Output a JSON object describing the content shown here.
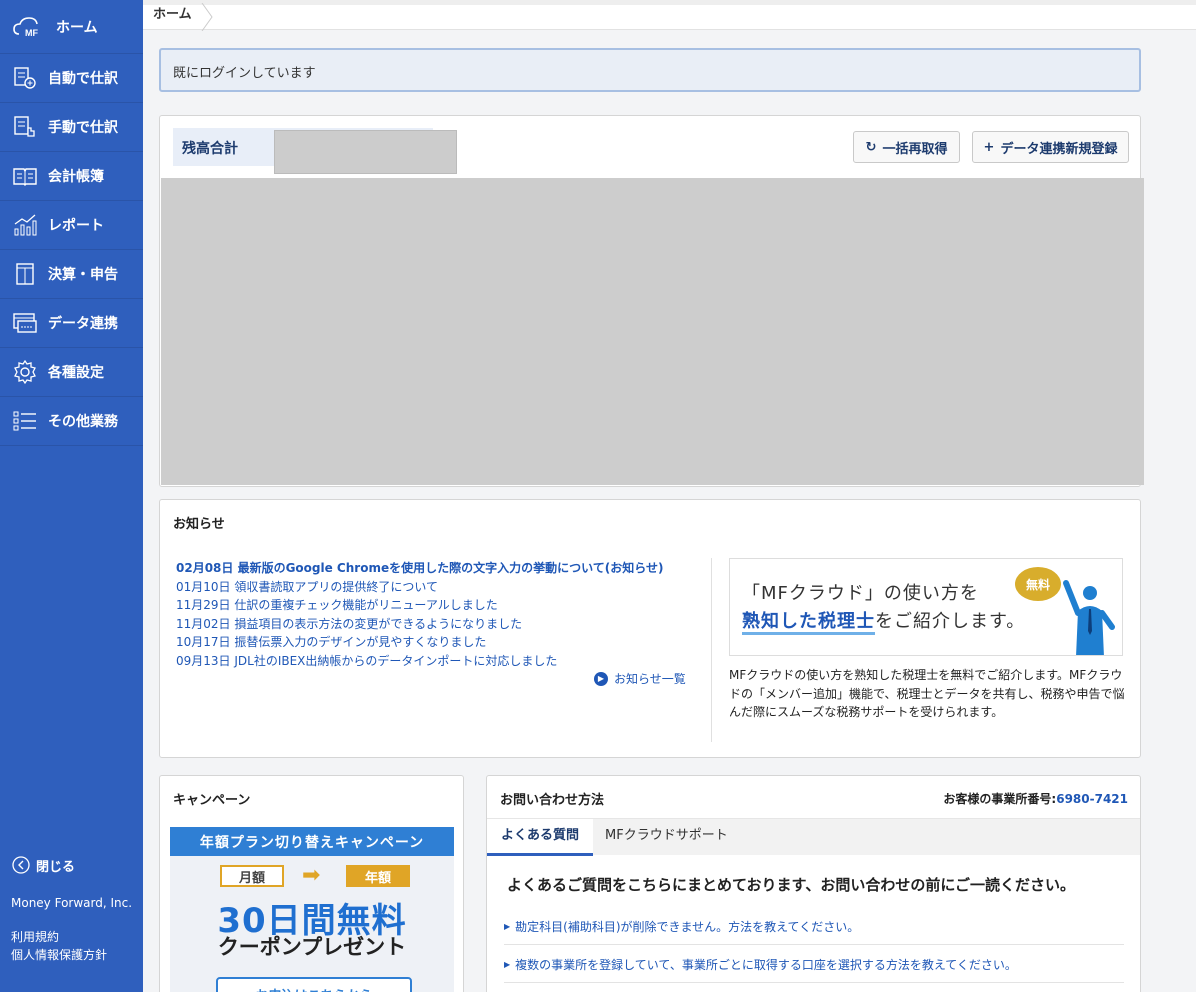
{
  "sidebar": {
    "items": [
      {
        "label": "ホーム",
        "icon": "cloud-icon"
      },
      {
        "label": "自動で仕訳",
        "icon": "auto-journal-icon"
      },
      {
        "label": "手動で仕訳",
        "icon": "manual-journal-icon"
      },
      {
        "label": "会計帳簿",
        "icon": "book-icon"
      },
      {
        "label": "レポート",
        "icon": "chart-icon"
      },
      {
        "label": "決算・申告",
        "icon": "document-icon"
      },
      {
        "label": "データ連携",
        "icon": "card-icon"
      },
      {
        "label": "各種設定",
        "icon": "gear-icon"
      },
      {
        "label": "その他業務",
        "icon": "list-icon"
      }
    ],
    "logo_text": "MF",
    "close_label": "閉じる",
    "company": "Money Forward, Inc.",
    "terms": "利用規約",
    "privacy": "個人情報保護方針"
  },
  "breadcrumb": {
    "home": "ホーム"
  },
  "alert": {
    "message": "既にログインしています"
  },
  "balance": {
    "title": "残高合計",
    "refetch_button": "一括再取得",
    "new_link_button": "データ連携新規登録"
  },
  "notice": {
    "title": "お知らせ",
    "items": [
      "02月08日 最新版のGoogle Chromeを使用した際の文字入力の挙動について(お知らせ)",
      "01月10日 領収書読取アプリの提供終了について",
      "11月29日 仕訳の重複チェック機能がリニューアルしました",
      "11月02日 損益項目の表示方法の変更ができるようになりました",
      "10月17日 振替伝票入力のデザインが見やすくなりました",
      "09月13日 JDL社のIBEX出納帳からのデータインポートに対応しました"
    ],
    "all_link": "お知らせ一覧",
    "banner": {
      "line1": "「MFクラウド」の使い方を",
      "highlight": "熟知した税理士",
      "line2_rest": "をご紹介します。",
      "badge": "無料"
    },
    "description": "MFクラウドの使い方を熟知した税理士を無料でご紹介します。MFクラウドの「メンバー追加」機能で、税理士とデータを共有し、税務や申告で悩んだ際にスムーズな税務サポートを受けられます。"
  },
  "campaign": {
    "title": "キャンペーン",
    "banner_head": "年額プラン切り替えキャンペーン",
    "monthly": "月額",
    "yearly": "年額",
    "big": "30日間無料",
    "coupon": "クーポンプレゼント",
    "apply": "お申込はこちらから"
  },
  "contact": {
    "title": "お問い合わせ方法",
    "office_label": "お客様の事業所番号:",
    "office_number": "6980-7421",
    "tabs": [
      "よくある質問",
      "MFクラウドサポート"
    ],
    "lead": "よくあるご質問をこちらにまとめております、お問い合わせの前にご一読ください。",
    "faq": [
      "勘定科目(補助科目)が削除できません。方法を教えてください。",
      "複数の事業所を登録していて、事業所ごとに取得する口座を選択する方法を教えてください。"
    ]
  },
  "colors": {
    "sidebar": "#2f5fbd",
    "link": "#1f57b6",
    "accent_gold": "#e0a526"
  }
}
